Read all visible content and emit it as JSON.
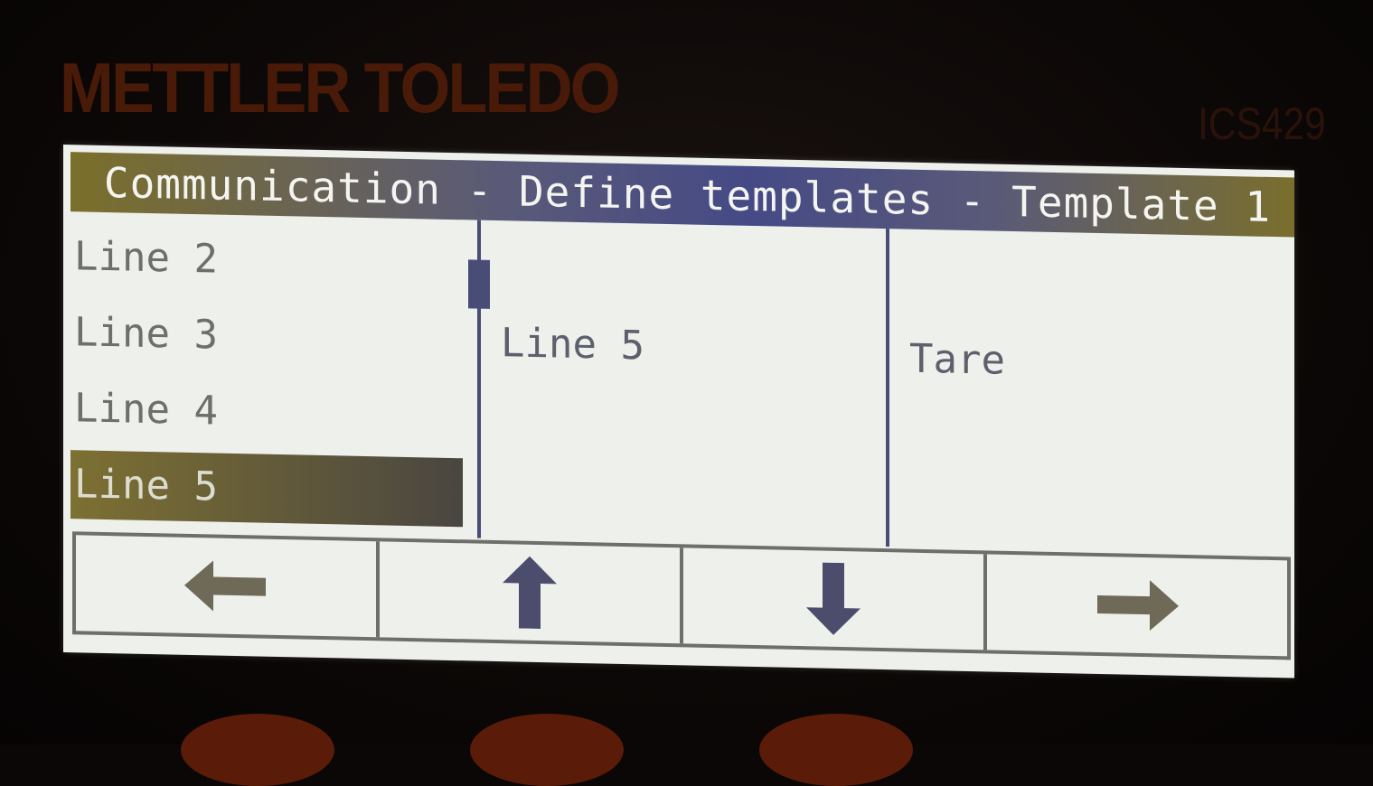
{
  "device": {
    "brand": "METTLER TOLEDO",
    "model": "ICS429"
  },
  "screen": {
    "title": "Communication - Define templates - Template 1",
    "list": {
      "items": [
        {
          "label": "Line 2",
          "selected": false
        },
        {
          "label": "Line 3",
          "selected": false
        },
        {
          "label": "Line 4",
          "selected": false
        },
        {
          "label": "Line 5",
          "selected": true
        }
      ]
    },
    "middle_value": "Line 5",
    "right_value": "Tare",
    "softkeys": [
      {
        "icon": "arrow-left-icon"
      },
      {
        "icon": "arrow-up-icon"
      },
      {
        "icon": "arrow-down-icon"
      },
      {
        "icon": "arrow-right-icon"
      }
    ]
  },
  "colors": {
    "screen_bg": "#eef0ec",
    "title_accent": "#454a86",
    "selection": "#7d7032",
    "brand": "#4a1a08"
  }
}
